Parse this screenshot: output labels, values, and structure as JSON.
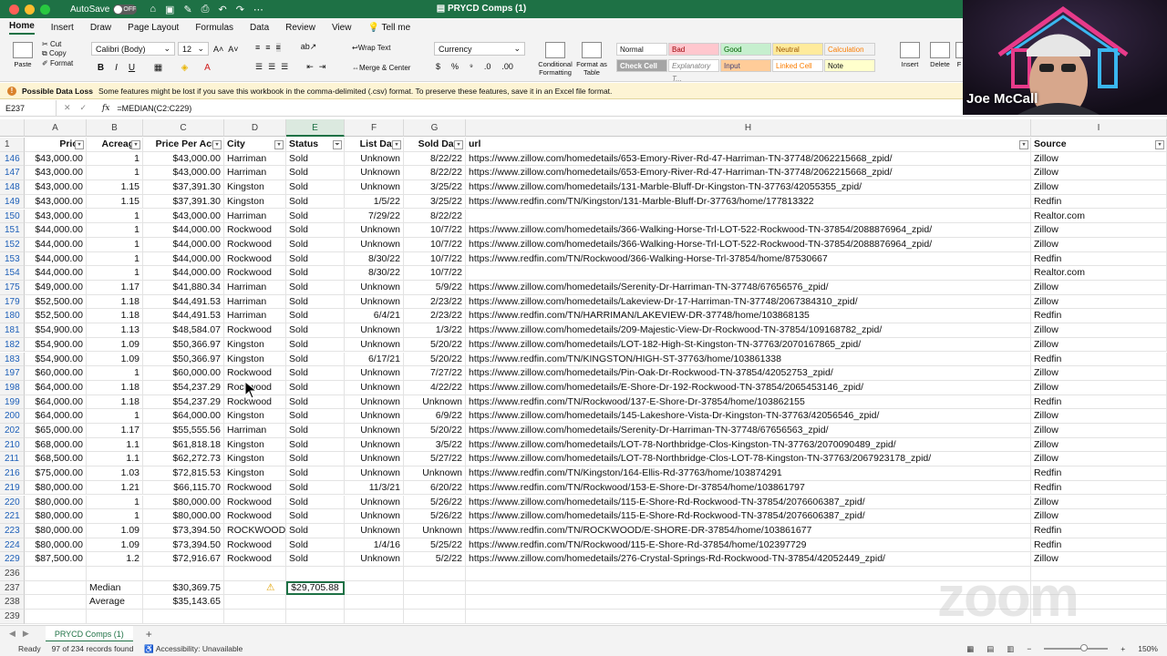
{
  "window": {
    "title": "PRYCD Comps (1)",
    "autosave_label": "AutoSave",
    "autosave_state": "OFF"
  },
  "menu": [
    "Home",
    "Insert",
    "Draw",
    "Page Layout",
    "Formulas",
    "Data",
    "Review",
    "View",
    "Tell me"
  ],
  "ribbon": {
    "paste": "Paste",
    "cut": "Cut",
    "copy": "Copy",
    "format": "Format",
    "font": "Calibri (Body)",
    "font_size": "12",
    "wrap_text": "Wrap Text",
    "merge_center": "Merge & Center",
    "number_format": "Currency",
    "conditional_formatting": "Conditional Formatting",
    "format_as_table": "Format as Table",
    "styles": [
      "Normal",
      "Bad",
      "Good",
      "Neutral",
      "Calculation",
      "Check Cell",
      "Explanatory T...",
      "Input",
      "Linked Cell",
      "Note"
    ],
    "insert": "Insert",
    "delete": "Delete",
    "format_cells": "F"
  },
  "message_bar": {
    "title": "Possible Data Loss",
    "text": "Some features might be lost if you save this workbook in the comma-delimited (.csv) format. To preserve these features, save it in an Excel file format."
  },
  "formula_bar": {
    "name_box": "E237",
    "formula": "=MEDIAN(C2:C229)"
  },
  "columns": [
    "A",
    "B",
    "C",
    "D",
    "E",
    "F",
    "G",
    "H",
    "I"
  ],
  "headers": [
    "Price",
    "Acreage",
    "Price Per Acre",
    "City",
    "Status",
    "List Date",
    "Sold Date",
    "url",
    "Source"
  ],
  "rows": [
    {
      "n": "146",
      "price": "$43,000.00",
      "acreage": "1",
      "ppa": "$43,000.00",
      "city": "Harriman",
      "status": "Sold",
      "list": "Unknown",
      "sold": "8/22/22",
      "url": "https://www.zillow.com/homedetails/653-Emory-River-Rd-47-Harriman-TN-37748/2062215668_zpid/",
      "source": "Zillow"
    },
    {
      "n": "147",
      "price": "$43,000.00",
      "acreage": "1",
      "ppa": "$43,000.00",
      "city": "Harriman",
      "status": "Sold",
      "list": "Unknown",
      "sold": "8/22/22",
      "url": "https://www.zillow.com/homedetails/653-Emory-River-Rd-47-Harriman-TN-37748/2062215668_zpid/",
      "source": "Zillow"
    },
    {
      "n": "148",
      "price": "$43,000.00",
      "acreage": "1.15",
      "ppa": "$37,391.30",
      "city": "Kingston",
      "status": "Sold",
      "list": "Unknown",
      "sold": "3/25/22",
      "url": "https://www.zillow.com/homedetails/131-Marble-Bluff-Dr-Kingston-TN-37763/42055355_zpid/",
      "source": "Zillow"
    },
    {
      "n": "149",
      "price": "$43,000.00",
      "acreage": "1.15",
      "ppa": "$37,391.30",
      "city": "Kingston",
      "status": "Sold",
      "list": "1/5/22",
      "sold": "3/25/22",
      "url": "https://www.redfin.com/TN/Kingston/131-Marble-Bluff-Dr-37763/home/177813322",
      "source": "Redfin"
    },
    {
      "n": "150",
      "price": "$43,000.00",
      "acreage": "1",
      "ppa": "$43,000.00",
      "city": "Harriman",
      "status": "Sold",
      "list": "7/29/22",
      "sold": "8/22/22",
      "url": "",
      "source": "Realtor.com"
    },
    {
      "n": "151",
      "price": "$44,000.00",
      "acreage": "1",
      "ppa": "$44,000.00",
      "city": "Rockwood",
      "status": "Sold",
      "list": "Unknown",
      "sold": "10/7/22",
      "url": "https://www.zillow.com/homedetails/366-Walking-Horse-Trl-LOT-522-Rockwood-TN-37854/2088876964_zpid/",
      "source": "Zillow"
    },
    {
      "n": "152",
      "price": "$44,000.00",
      "acreage": "1",
      "ppa": "$44,000.00",
      "city": "Rockwood",
      "status": "Sold",
      "list": "Unknown",
      "sold": "10/7/22",
      "url": "https://www.zillow.com/homedetails/366-Walking-Horse-Trl-LOT-522-Rockwood-TN-37854/2088876964_zpid/",
      "source": "Zillow"
    },
    {
      "n": "153",
      "price": "$44,000.00",
      "acreage": "1",
      "ppa": "$44,000.00",
      "city": "Rockwood",
      "status": "Sold",
      "list": "8/30/22",
      "sold": "10/7/22",
      "url": "https://www.redfin.com/TN/Rockwood/366-Walking-Horse-Trl-37854/home/87530667",
      "source": "Redfin"
    },
    {
      "n": "154",
      "price": "$44,000.00",
      "acreage": "1",
      "ppa": "$44,000.00",
      "city": "Rockwood",
      "status": "Sold",
      "list": "8/30/22",
      "sold": "10/7/22",
      "url": "",
      "source": "Realtor.com"
    },
    {
      "n": "175",
      "price": "$49,000.00",
      "acreage": "1.17",
      "ppa": "$41,880.34",
      "city": "Harriman",
      "status": "Sold",
      "list": "Unknown",
      "sold": "5/9/22",
      "url": "https://www.zillow.com/homedetails/Serenity-Dr-Harriman-TN-37748/67656576_zpid/",
      "source": "Zillow"
    },
    {
      "n": "179",
      "price": "$52,500.00",
      "acreage": "1.18",
      "ppa": "$44,491.53",
      "city": "Harriman",
      "status": "Sold",
      "list": "Unknown",
      "sold": "2/23/22",
      "url": "https://www.zillow.com/homedetails/Lakeview-Dr-17-Harriman-TN-37748/2067384310_zpid/",
      "source": "Zillow"
    },
    {
      "n": "180",
      "price": "$52,500.00",
      "acreage": "1.18",
      "ppa": "$44,491.53",
      "city": "Harriman",
      "status": "Sold",
      "list": "6/4/21",
      "sold": "2/23/22",
      "url": "https://www.redfin.com/TN/HARRIMAN/LAKEVIEW-DR-37748/home/103868135",
      "source": "Redfin"
    },
    {
      "n": "181",
      "price": "$54,900.00",
      "acreage": "1.13",
      "ppa": "$48,584.07",
      "city": "Rockwood",
      "status": "Sold",
      "list": "Unknown",
      "sold": "1/3/22",
      "url": "https://www.zillow.com/homedetails/209-Majestic-View-Dr-Rockwood-TN-37854/109168782_zpid/",
      "source": "Zillow"
    },
    {
      "n": "182",
      "price": "$54,900.00",
      "acreage": "1.09",
      "ppa": "$50,366.97",
      "city": "Kingston",
      "status": "Sold",
      "list": "Unknown",
      "sold": "5/20/22",
      "url": "https://www.zillow.com/homedetails/LOT-182-High-St-Kingston-TN-37763/2070167865_zpid/",
      "source": "Zillow"
    },
    {
      "n": "183",
      "price": "$54,900.00",
      "acreage": "1.09",
      "ppa": "$50,366.97",
      "city": "Kingston",
      "status": "Sold",
      "list": "6/17/21",
      "sold": "5/20/22",
      "url": "https://www.redfin.com/TN/KINGSTON/HIGH-ST-37763/home/103861338",
      "source": "Redfin"
    },
    {
      "n": "197",
      "price": "$60,000.00",
      "acreage": "1",
      "ppa": "$60,000.00",
      "city": "Rockwood",
      "status": "Sold",
      "list": "Unknown",
      "sold": "7/27/22",
      "url": "https://www.zillow.com/homedetails/Pin-Oak-Dr-Rockwood-TN-37854/42052753_zpid/",
      "source": "Zillow"
    },
    {
      "n": "198",
      "price": "$64,000.00",
      "acreage": "1.18",
      "ppa": "$54,237.29",
      "city": "Rockwood",
      "status": "Sold",
      "list": "Unknown",
      "sold": "4/22/22",
      "url": "https://www.zillow.com/homedetails/E-Shore-Dr-192-Rockwood-TN-37854/2065453146_zpid/",
      "source": "Zillow"
    },
    {
      "n": "199",
      "price": "$64,000.00",
      "acreage": "1.18",
      "ppa": "$54,237.29",
      "city": "Rockwood",
      "status": "Sold",
      "list": "Unknown",
      "sold": "Unknown",
      "url": "https://www.redfin.com/TN/Rockwood/137-E-Shore-Dr-37854/home/103862155",
      "source": "Redfin"
    },
    {
      "n": "200",
      "price": "$64,000.00",
      "acreage": "1",
      "ppa": "$64,000.00",
      "city": "Kingston",
      "status": "Sold",
      "list": "Unknown",
      "sold": "6/9/22",
      "url": "https://www.zillow.com/homedetails/145-Lakeshore-Vista-Dr-Kingston-TN-37763/42056546_zpid/",
      "source": "Zillow"
    },
    {
      "n": "202",
      "price": "$65,000.00",
      "acreage": "1.17",
      "ppa": "$55,555.56",
      "city": "Harriman",
      "status": "Sold",
      "list": "Unknown",
      "sold": "5/20/22",
      "url": "https://www.zillow.com/homedetails/Serenity-Dr-Harriman-TN-37748/67656563_zpid/",
      "source": "Zillow"
    },
    {
      "n": "210",
      "price": "$68,000.00",
      "acreage": "1.1",
      "ppa": "$61,818.18",
      "city": "Kingston",
      "status": "Sold",
      "list": "Unknown",
      "sold": "3/5/22",
      "url": "https://www.zillow.com/homedetails/LOT-78-Northbridge-Clos-Kingston-TN-37763/2070090489_zpid/",
      "source": "Zillow"
    },
    {
      "n": "211",
      "price": "$68,500.00",
      "acreage": "1.1",
      "ppa": "$62,272.73",
      "city": "Kingston",
      "status": "Sold",
      "list": "Unknown",
      "sold": "5/27/22",
      "url": "https://www.zillow.com/homedetails/LOT-78-Northbridge-Clos-LOT-78-Kingston-TN-37763/2067923178_zpid/",
      "source": "Zillow"
    },
    {
      "n": "216",
      "price": "$75,000.00",
      "acreage": "1.03",
      "ppa": "$72,815.53",
      "city": "Kingston",
      "status": "Sold",
      "list": "Unknown",
      "sold": "Unknown",
      "url": "https://www.redfin.com/TN/Kingston/164-Ellis-Rd-37763/home/103874291",
      "source": "Redfin"
    },
    {
      "n": "219",
      "price": "$80,000.00",
      "acreage": "1.21",
      "ppa": "$66,115.70",
      "city": "Rockwood",
      "status": "Sold",
      "list": "11/3/21",
      "sold": "6/20/22",
      "url": "https://www.redfin.com/TN/Rockwood/153-E-Shore-Dr-37854/home/103861797",
      "source": "Redfin"
    },
    {
      "n": "220",
      "price": "$80,000.00",
      "acreage": "1",
      "ppa": "$80,000.00",
      "city": "Rockwood",
      "status": "Sold",
      "list": "Unknown",
      "sold": "5/26/22",
      "url": "https://www.zillow.com/homedetails/115-E-Shore-Rd-Rockwood-TN-37854/2076606387_zpid/",
      "source": "Zillow"
    },
    {
      "n": "221",
      "price": "$80,000.00",
      "acreage": "1",
      "ppa": "$80,000.00",
      "city": "Rockwood",
      "status": "Sold",
      "list": "Unknown",
      "sold": "5/26/22",
      "url": "https://www.zillow.com/homedetails/115-E-Shore-Rd-Rockwood-TN-37854/2076606387_zpid/",
      "source": "Zillow"
    },
    {
      "n": "223",
      "price": "$80,000.00",
      "acreage": "1.09",
      "ppa": "$73,394.50",
      "city": "ROCKWOOD",
      "status": "Sold",
      "list": "Unknown",
      "sold": "Unknown",
      "url": "https://www.redfin.com/TN/ROCKWOOD/E-SHORE-DR-37854/home/103861677",
      "source": "Redfin"
    },
    {
      "n": "224",
      "price": "$80,000.00",
      "acreage": "1.09",
      "ppa": "$73,394.50",
      "city": "Rockwood",
      "status": "Sold",
      "list": "1/4/16",
      "sold": "5/25/22",
      "url": "https://www.redfin.com/TN/Rockwood/115-E-Shore-Rd-37854/home/102397729",
      "source": "Redfin"
    },
    {
      "n": "229",
      "price": "$87,500.00",
      "acreage": "1.2",
      "ppa": "$72,916.67",
      "city": "Rockwood",
      "status": "Sold",
      "list": "Unknown",
      "sold": "5/2/22",
      "url": "https://www.zillow.com/homedetails/276-Crystal-Springs-Rd-Rockwood-TN-37854/42052449_zpid/",
      "source": "Zillow"
    }
  ],
  "summary": {
    "row_blank": "236",
    "median_row": "237",
    "median_label": "Median",
    "median_ppa": "$30,369.75",
    "median_selected": "$29,705.88",
    "average_row": "238",
    "average_label": "Average",
    "average_ppa": "$35,143.65",
    "row_last": "239"
  },
  "sheet_tab": "PRYCD Comps (1)",
  "status": {
    "ready": "Ready",
    "records": "97 of 234 records found",
    "accessibility": "Accessibility: Unavailable",
    "zoom": "150%"
  },
  "webcam": {
    "name": "Joe McCall"
  },
  "watermark": "zoom",
  "colors": {
    "excel_green": "#1e7145",
    "link_blue": "#1d5fb8"
  }
}
